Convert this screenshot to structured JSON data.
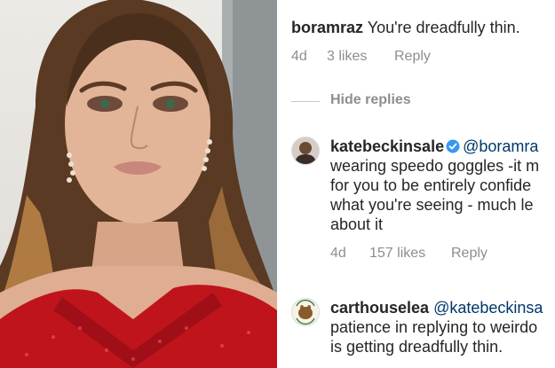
{
  "comments": [
    {
      "username": "boramraz",
      "text": "You're dreadfully thin.",
      "meta": {
        "time": "4d",
        "likes": "3 likes",
        "reply": "Reply"
      }
    }
  ],
  "hide_replies": "Hide replies",
  "replies": [
    {
      "username": "katebeckinsale",
      "verified": true,
      "mention": "@boramra",
      "lines": [
        "wearing speedo goggles -it m",
        "for you to be entirely confide",
        "what you're seeing - much le",
        "about it"
      ],
      "meta": {
        "time": "4d",
        "likes": "157 likes",
        "reply": "Reply"
      }
    },
    {
      "username": "carthouselea",
      "mention": "@katebeckinsa",
      "lines": [
        "patience in replying to weirdo",
        "is getting dreadfully thin."
      ],
      "avatar_text": "carthouse cooking"
    }
  ],
  "colors": {
    "meta_gray": "#8e8e8e",
    "text": "#262626",
    "mention": "#00376b",
    "verified_blue": "#3897f0",
    "dress_red": "#c0141c"
  },
  "icons": [
    "verified-badge-icon"
  ]
}
